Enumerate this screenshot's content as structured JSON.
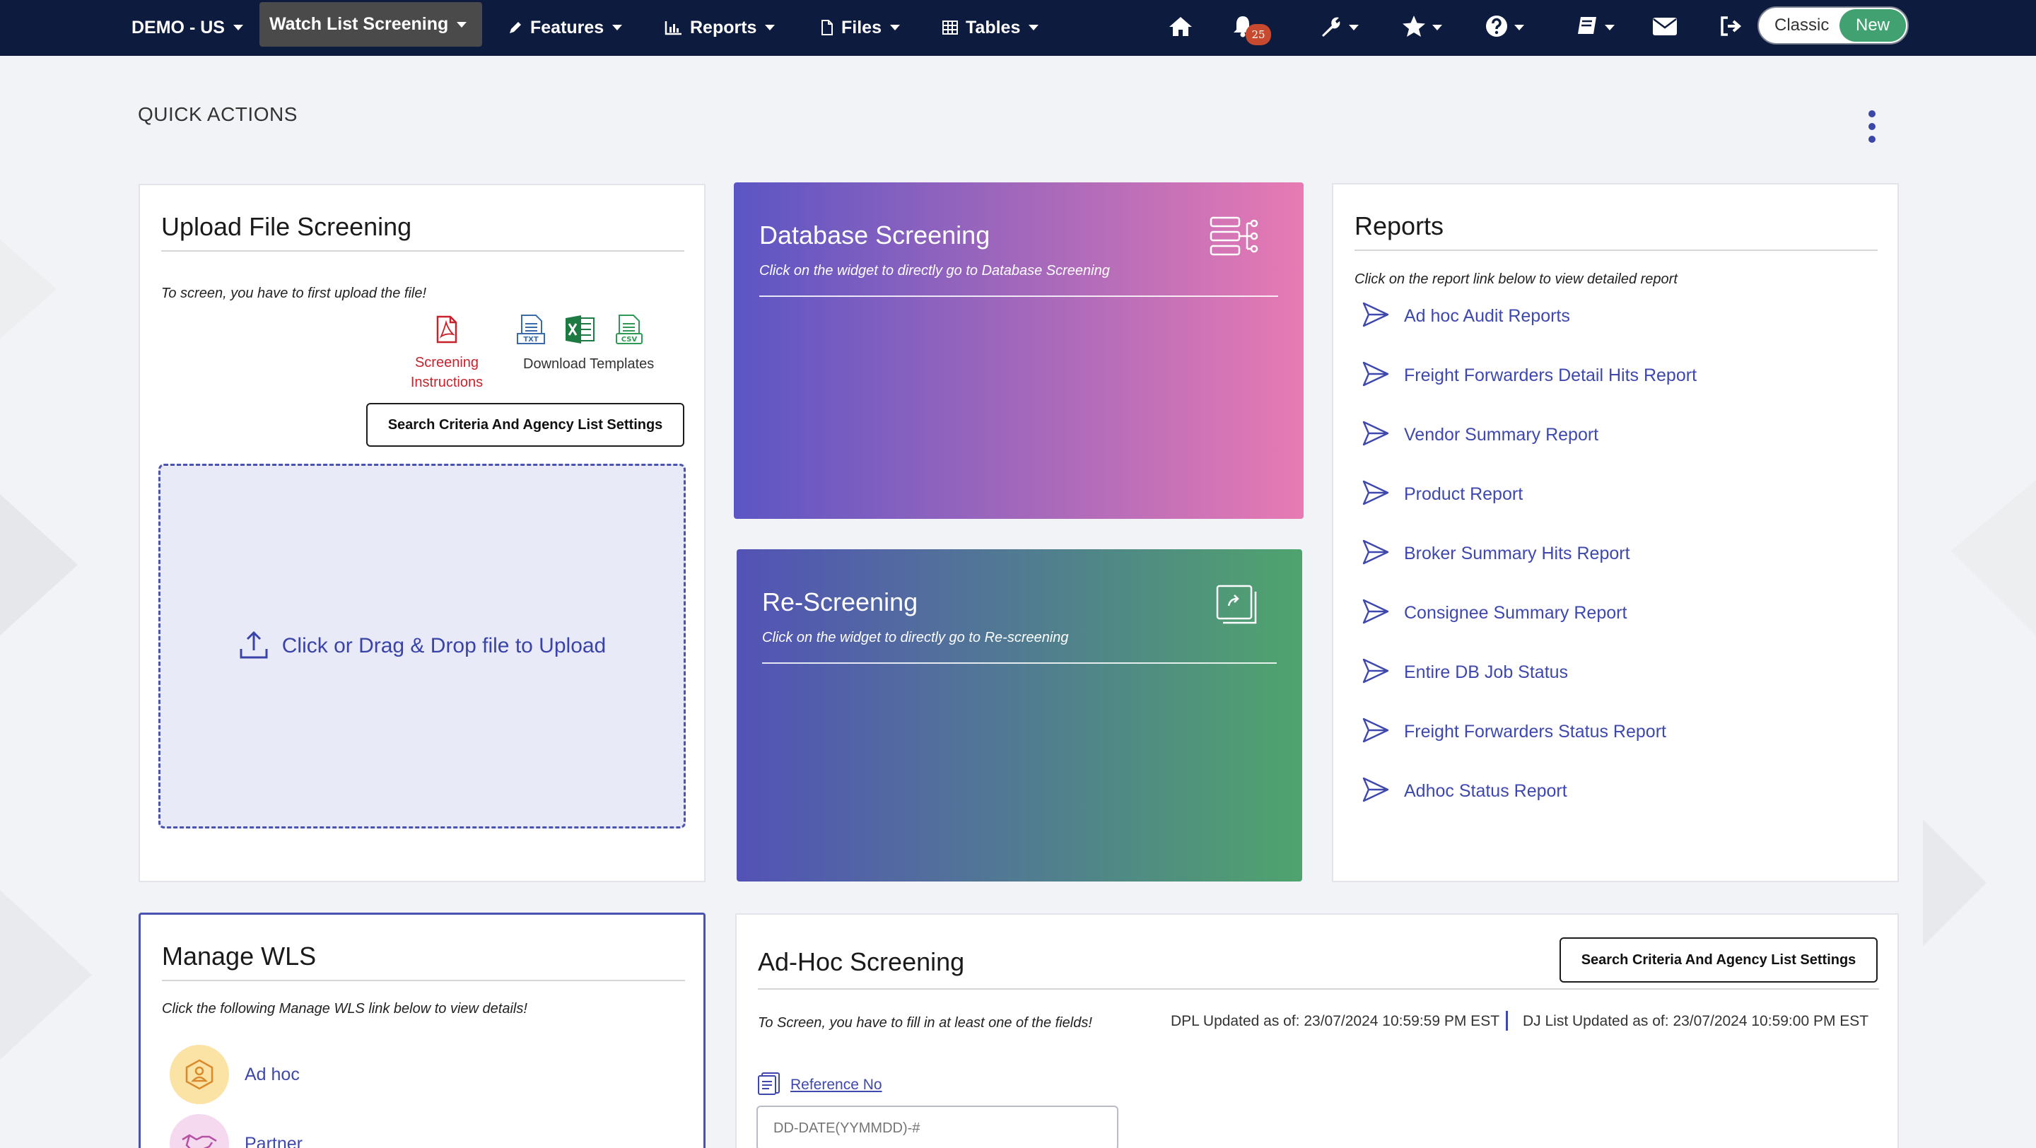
{
  "navbar": {
    "brand": "DEMO - US",
    "active_menu": "Watch List Screening",
    "menus": [
      "Features",
      "Reports",
      "Files",
      "Tables"
    ],
    "notification_count": "25",
    "toggle": {
      "off_label": "Classic",
      "on_label": "New"
    },
    "colors": {
      "bg": "#0d1b3e",
      "toggle_on": "#41a171",
      "badge": "#c74a2e"
    }
  },
  "quick_actions": {
    "title": "QUICK ACTIONS"
  },
  "upload": {
    "title": "Upload File Screening",
    "hint": "To screen, you have to first upload the file!",
    "instructions_label": "Screening Instructions",
    "download_label": "Download Templates",
    "template_types": [
      "TXT",
      "XLS",
      "CSV"
    ],
    "settings_button": "Search Criteria And Agency List Settings",
    "dropzone_label": "Click or Drag & Drop file to Upload"
  },
  "database_screening": {
    "title": "Database Screening",
    "subtitle": "Click on the widget to directly go to Database Screening",
    "colors": [
      "#5b55c4",
      "#e87ab3"
    ]
  },
  "rescreening": {
    "title": "Re-Screening",
    "subtitle": "Click on the widget to directly go to Re-screening",
    "colors": [
      "#5352b6",
      "#4fa46d"
    ]
  },
  "reports": {
    "title": "Reports",
    "hint": "Click on the report link below to view detailed report",
    "items": [
      "Ad hoc Audit Reports",
      "Freight Forwarders Detail Hits Report",
      "Vendor Summary Report",
      "Product Report",
      "Broker Summary Hits Report",
      "Consignee Summary Report",
      "Entire DB Job Status",
      "Freight Forwarders Status Report",
      "Adhoc Status Report"
    ]
  },
  "manage_wls": {
    "title": "Manage WLS",
    "hint": "Click the following Manage WLS link below to view details!",
    "items": [
      "Ad hoc",
      "Partner"
    ]
  },
  "adhoc": {
    "title": "Ad-Hoc Screening",
    "settings_button": "Search Criteria And Agency List Settings",
    "hint": "To Screen, you have to fill in at least one of the fields!",
    "dpl_updated": "DPL Updated as of: 23/07/2024 10:59:59 PM EST",
    "dj_updated": "DJ List Updated as of: 23/07/2024 10:59:00 PM EST",
    "reference_label": "Reference No",
    "reference_placeholder": "DD-DATE(YYMMDD)-#"
  }
}
